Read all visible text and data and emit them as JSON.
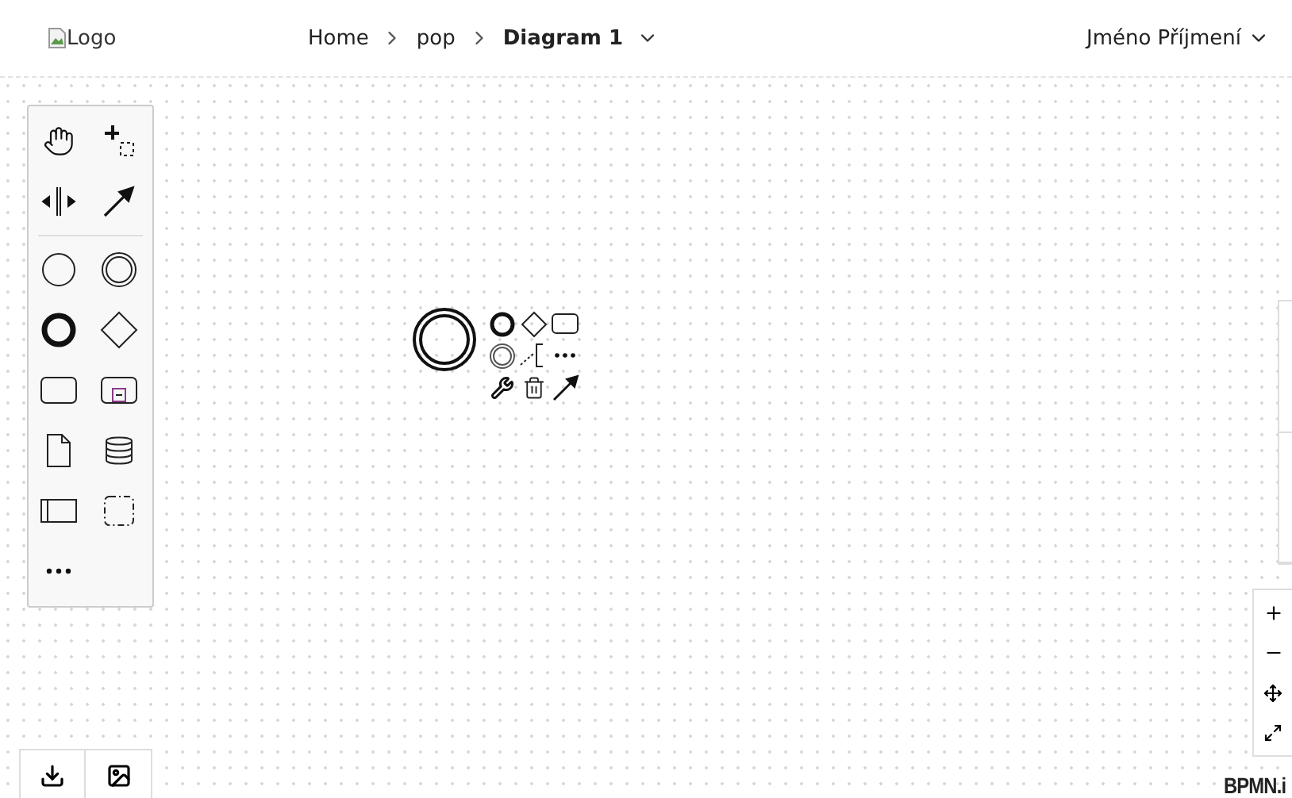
{
  "header": {
    "logo_alt": "Logo",
    "breadcrumb": [
      {
        "label": "Home",
        "current": false
      },
      {
        "label": "pop",
        "current": false
      },
      {
        "label": "Diagram 1",
        "current": true
      }
    ],
    "user": "Jméno Příjmení"
  },
  "palette": [
    {
      "kind": "hand"
    },
    {
      "kind": "lasso"
    },
    {
      "kind": "space"
    },
    {
      "kind": "connect"
    },
    {
      "kind": "separator"
    },
    {
      "kind": "start-event"
    },
    {
      "kind": "intermediate-event"
    },
    {
      "kind": "end-event"
    },
    {
      "kind": "gateway"
    },
    {
      "kind": "task"
    },
    {
      "kind": "subprocess"
    },
    {
      "kind": "data-object"
    },
    {
      "kind": "data-store"
    },
    {
      "kind": "pool"
    },
    {
      "kind": "group"
    },
    {
      "kind": "more"
    }
  ],
  "context_pad": [
    {
      "kind": "end-event"
    },
    {
      "kind": "gateway"
    },
    {
      "kind": "task"
    },
    {
      "kind": "intermediate-event"
    },
    {
      "kind": "annotation"
    },
    {
      "kind": "more"
    },
    {
      "kind": "wrench"
    },
    {
      "kind": "trash"
    },
    {
      "kind": "connect"
    }
  ],
  "zoom_controls": [
    {
      "kind": "zoom-in"
    },
    {
      "kind": "zoom-out"
    },
    {
      "kind": "fit"
    },
    {
      "kind": "fullscreen"
    }
  ],
  "export_buttons": [
    {
      "kind": "download"
    },
    {
      "kind": "image"
    }
  ],
  "watermark": "BPMN.i"
}
